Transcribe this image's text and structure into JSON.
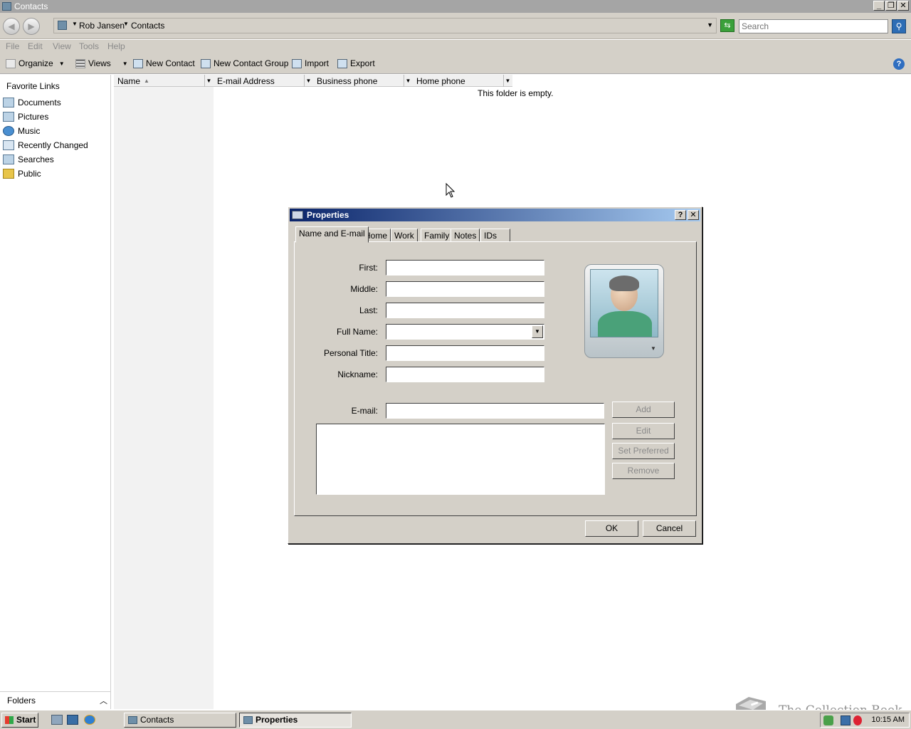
{
  "window": {
    "title": "Contacts"
  },
  "address": {
    "crumbs": [
      "Rob Jansen",
      "Contacts"
    ],
    "search_placeholder": "Search"
  },
  "menu": [
    "File",
    "Edit",
    "View",
    "Tools",
    "Help"
  ],
  "toolbar": {
    "organize": "Organize",
    "views": "Views",
    "new_contact": "New Contact",
    "new_contact_group": "New Contact Group",
    "import": "Import",
    "export": "Export"
  },
  "nav": {
    "header": "Favorite Links",
    "links": [
      "Documents",
      "Pictures",
      "Music",
      "Recently Changed",
      "Searches",
      "Public"
    ],
    "folders_label": "Folders"
  },
  "list": {
    "columns": [
      "Name",
      "E-mail Address",
      "Business phone",
      "Home phone"
    ],
    "empty_message": "This folder is empty."
  },
  "dialog": {
    "title": "Properties",
    "tabs": [
      "Name and E-mail",
      "Home",
      "Work",
      "Family",
      "Notes",
      "IDs"
    ],
    "labels": {
      "first": "First:",
      "middle": "Middle:",
      "last": "Last:",
      "full_name": "Full Name:",
      "personal_title": "Personal Title:",
      "nickname": "Nickname:",
      "email": "E-mail:"
    },
    "values": {
      "first": "",
      "middle": "",
      "last": "",
      "full_name": "",
      "personal_title": "",
      "nickname": "",
      "email": ""
    },
    "buttons": {
      "add": "Add",
      "edit": "Edit",
      "set_preferred": "Set Preferred",
      "remove": "Remove",
      "ok": "OK",
      "cancel": "Cancel"
    }
  },
  "taskbar": {
    "start": "Start",
    "tasks": [
      "Contacts",
      "Properties"
    ],
    "clock": "10:15 AM"
  },
  "watermark": "The Collection Book",
  "colors": {
    "dialog_title_start": "#0a246a",
    "dialog_title_end": "#a6caf0",
    "chrome": "#d4d0c8"
  }
}
